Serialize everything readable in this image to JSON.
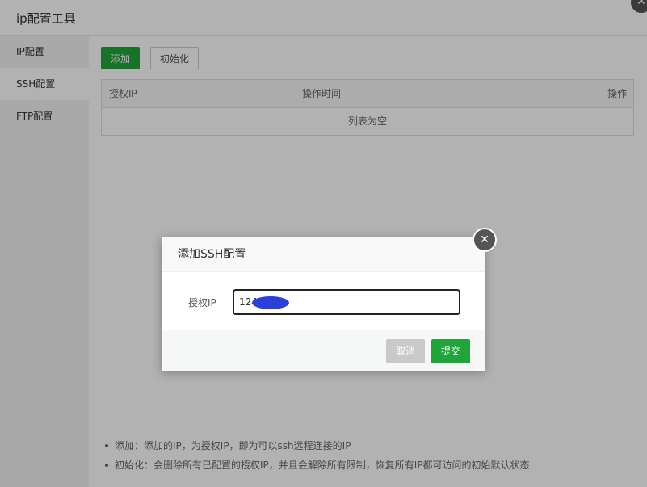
{
  "window": {
    "title": "ip配置工具",
    "close_icon": "close-icon"
  },
  "sidebar": {
    "items": [
      {
        "label": "IP配置"
      },
      {
        "label": "SSH配置"
      },
      {
        "label": "FTP配置"
      }
    ]
  },
  "toolbar": {
    "add_label": "添加",
    "init_label": "初始化"
  },
  "table": {
    "columns": [
      "授权IP",
      "操作时间",
      "操作"
    ],
    "empty_text": "列表为空"
  },
  "notes": [
    "添加：添加的IP，为授权IP，即为可以ssh远程连接的IP",
    "初始化：会删除所有已配置的授权IP，并且会解除所有限制，恢复所有IP都可访问的初始默认状态"
  ],
  "dialog": {
    "title": "添加SSH配置",
    "field_label": "授权IP",
    "field_value": "124",
    "cancel_label": "取消",
    "submit_label": "提交"
  },
  "colors": {
    "accent": "#20a53a",
    "disabled": "#c9c9c9",
    "overlay": "rgba(0,0,0,0.3)"
  }
}
